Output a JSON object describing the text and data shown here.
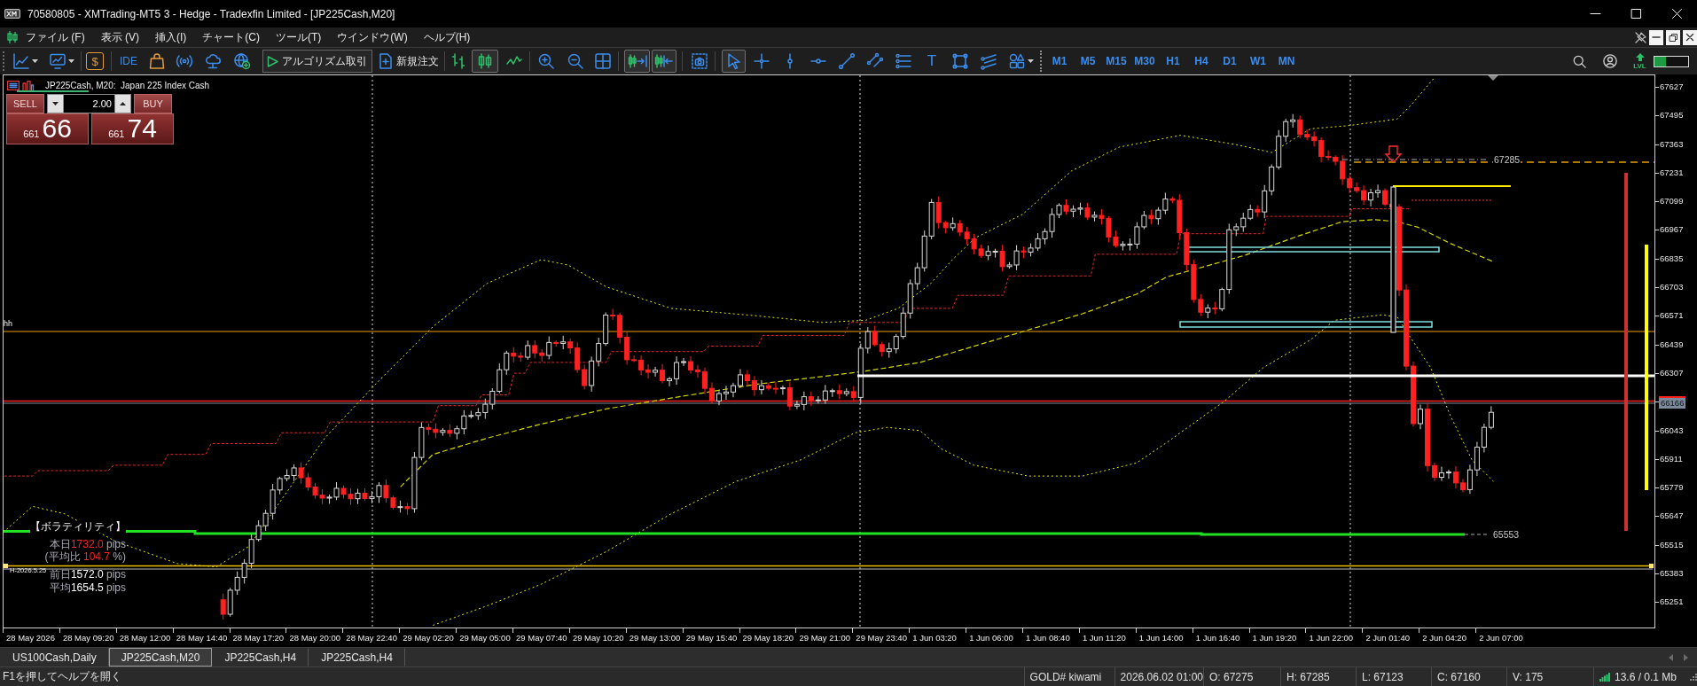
{
  "window": {
    "title": "70580805 - XMTrading-MT5 3 - Hedge - Tradexfin Limited - [JP225Cash,M20]"
  },
  "menu": [
    {
      "label": "ファイル (F)"
    },
    {
      "label": "表示 (V)"
    },
    {
      "label": "挿入(I)"
    },
    {
      "label": "チャート(C)"
    },
    {
      "label": "ツール(T)"
    },
    {
      "label": "ウインドウ(W)"
    },
    {
      "label": "ヘルプ(H)"
    }
  ],
  "toolbar": {
    "account_symbol": "$",
    "ide": "IDE",
    "algo_trading": "アルゴリズム取引",
    "new_order": "新規注文",
    "chart_types": [
      {
        "selected": false
      },
      {
        "selected": true
      },
      {
        "selected": false
      }
    ],
    "auto_scroll": {
      "on": true
    },
    "chart_shift": {
      "on": true
    },
    "drawing_tools": [
      {
        "kind": "icon",
        "selected": true
      },
      {
        "kind": "icon",
        "selected": false
      },
      {
        "kind": "icon",
        "selected": false
      },
      {
        "kind": "icon",
        "selected": false
      },
      {
        "kind": "icon",
        "selected": false
      },
      {
        "kind": "icon",
        "selected": false
      },
      {
        "kind": "icon",
        "selected": false
      },
      {
        "kind": "text",
        "label": "T",
        "selected": false
      },
      {
        "kind": "icon",
        "selected": false
      },
      {
        "kind": "icon",
        "selected": false
      },
      {
        "kind": "menu",
        "selected": false
      }
    ],
    "timeframes": [
      {
        "label": "M1",
        "selected": false
      },
      {
        "label": "M5",
        "selected": false
      },
      {
        "label": "M15",
        "selected": false
      },
      {
        "label": "M30",
        "selected": false
      },
      {
        "label": "H1",
        "selected": false
      },
      {
        "label": "H4",
        "selected": false
      },
      {
        "label": "D1",
        "selected": false
      },
      {
        "label": "W1",
        "selected": false
      },
      {
        "label": "MN",
        "selected": false
      }
    ],
    "lvl": "LVL",
    "meter": {
      "level": 0.33
    }
  },
  "trade_panel": {
    "caption": "JP225Cash, M20:  Japan 225 Index Cash",
    "sell": {
      "label": "SELL",
      "price_head": "661",
      "price_tail": "66"
    },
    "buy": {
      "label": "BUY",
      "price_head": "661",
      "price_tail": "74"
    },
    "volume": "2.00"
  },
  "chart": {
    "hh_label": "hh",
    "date_label": "H-2026.5.25",
    "upper_level_label": "67285",
    "lower_level_label": "65553",
    "price_axis": {
      "upper": [
        "67627",
        "67495",
        "67363",
        "67231",
        "67099",
        "66967",
        "66835",
        "66703",
        "66571",
        "66439",
        "66307"
      ],
      "current": "66166",
      "lower": [
        "66043",
        "65911",
        "65779",
        "65647",
        "65515",
        "65383",
        "65251"
      ]
    },
    "time_axis": [
      "28 May 2026",
      "28 May 09:20",
      "28 May 12:00",
      "28 May 14:40",
      "28 May 17:20",
      "28 May 20:00",
      "28 May 22:40",
      "29 May 02:20",
      "29 May 05:00",
      "29 May 07:40",
      "29 May 10:20",
      "29 May 13:00",
      "29 May 15:40",
      "29 May 18:20",
      "29 May 21:00",
      "29 May 23:40",
      "1 Jun 03:20",
      "1 Jun 06:00",
      "1 Jun 08:40",
      "1 Jun 11:20",
      "1 Jun 14:00",
      "1 Jun 16:40",
      "1 Jun 19:20",
      "1 Jun 22:00",
      "2 Jun 01:40",
      "2 Jun 04:20",
      "2 Jun 07:00"
    ]
  },
  "volatility": {
    "title": "【ボラティリティ】",
    "lines": [
      {
        "kind": "amount",
        "label": "本日",
        "value": "1732.0",
        "unit": "pips",
        "color": "#ff2020"
      },
      {
        "kind": "ratio",
        "label": "(平均比",
        "value": "104.7",
        "unit": "%)",
        "color": "#ff2020"
      },
      {
        "kind": "amount",
        "label": "前日",
        "value": "1572.0",
        "unit": "pips",
        "color": "#ffffff"
      },
      {
        "kind": "amount",
        "label": "平均",
        "value": "1654.5",
        "unit": "pips",
        "color": "#ffffff"
      }
    ]
  },
  "tabs": [
    {
      "label": "US100Cash,Daily",
      "selected": false
    },
    {
      "label": "JP225Cash,M20",
      "selected": true
    },
    {
      "label": "JP225Cash,H4",
      "selected": false
    },
    {
      "label": "JP225Cash,H4",
      "selected": false
    }
  ],
  "status_bar": {
    "help": "F1を押してヘルプを開く",
    "cells": [
      "GOLD# kiwami",
      "2026.06.02 01:00",
      "O: 67275",
      "H: 67285",
      "L: 67123",
      "C: 67160",
      "V: 175"
    ],
    "traffic": "13.6 / 0.1 Mb"
  }
}
